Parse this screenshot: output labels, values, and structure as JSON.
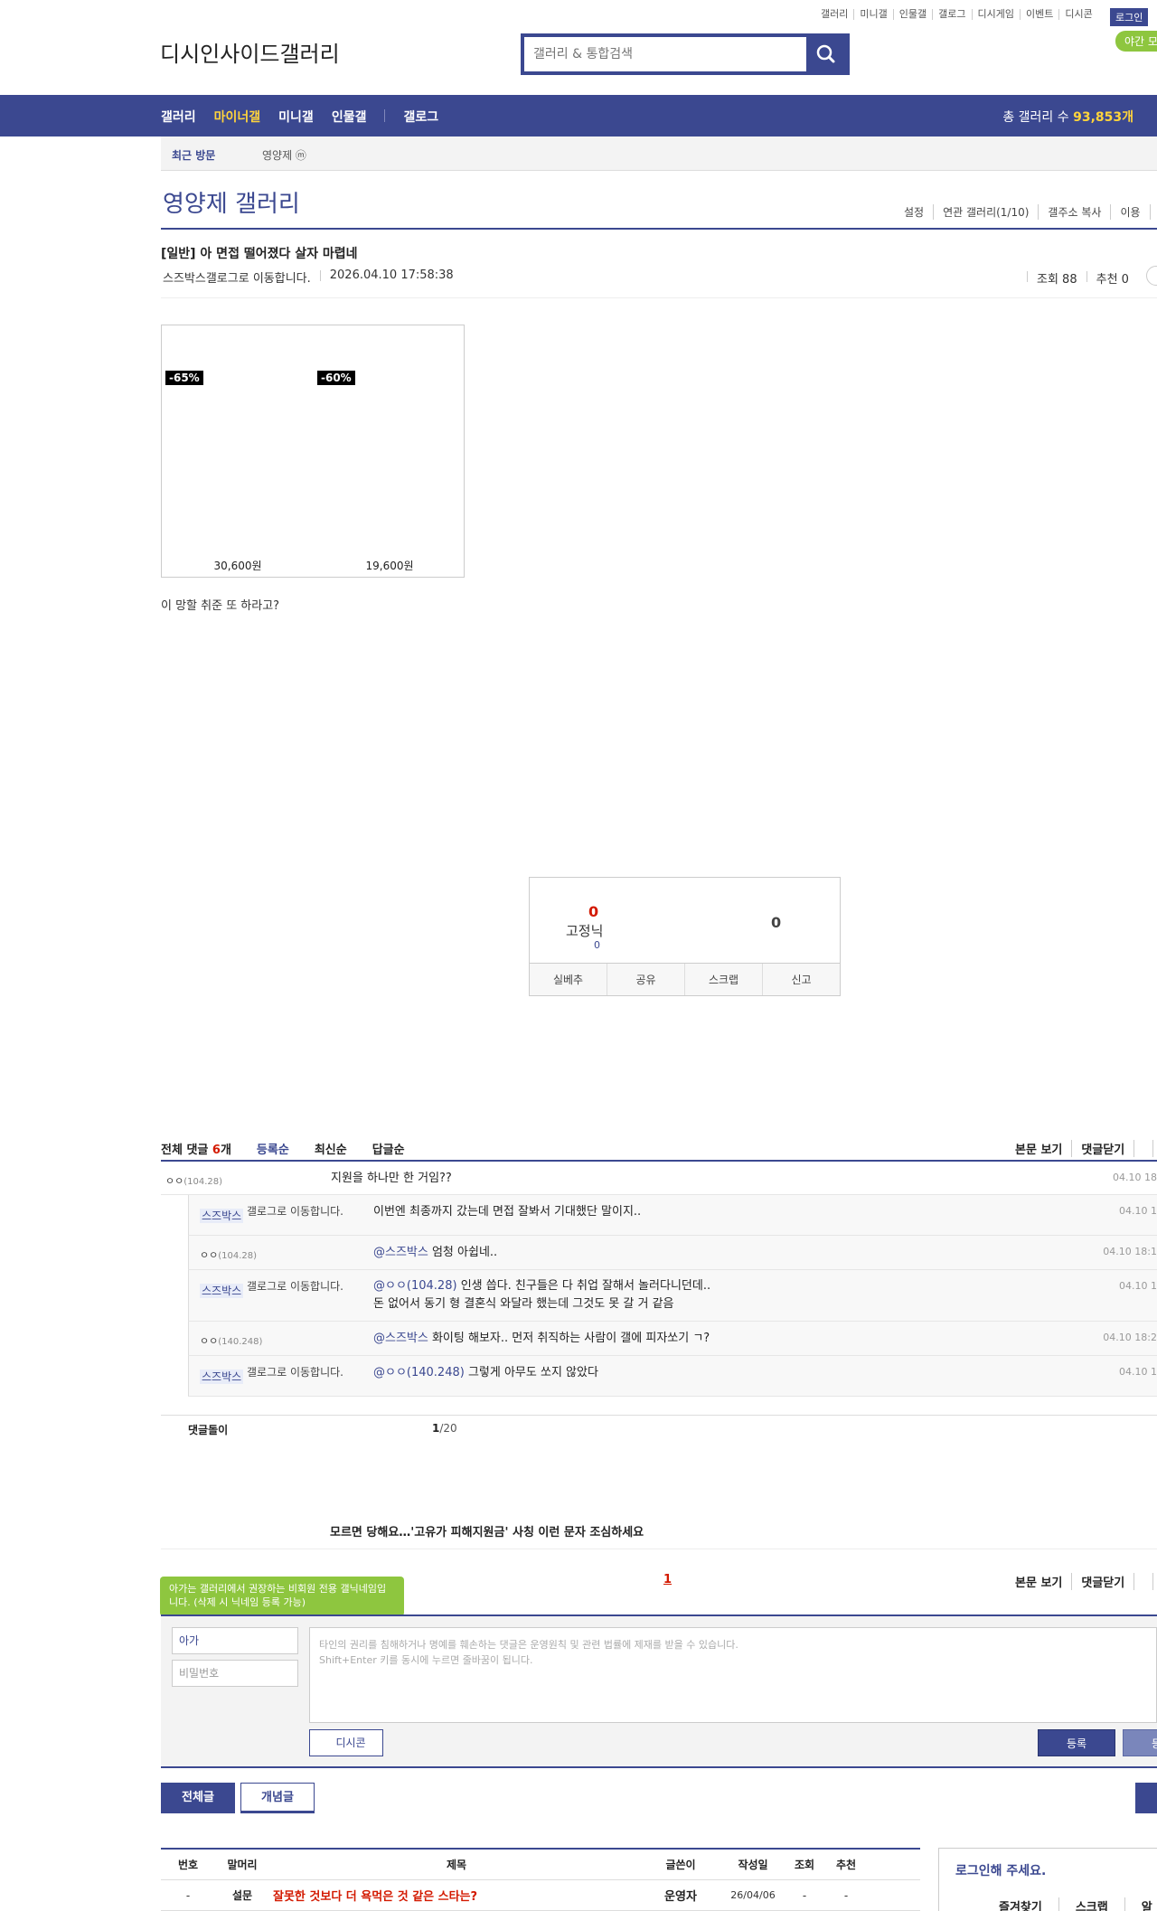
{
  "topnav": [
    "갤러리",
    "미니갤",
    "인물갤",
    "갤로그",
    "디시게임",
    "이벤트",
    "디시콘"
  ],
  "login_label": "로그인",
  "night_label": "야간 모",
  "logo_text": "디시인사이드갤러리",
  "search": {
    "placeholder": "갤러리 & 통합검색"
  },
  "gnb": {
    "items": [
      "갤러리",
      "마이너갤",
      "미니갤",
      "인물갤",
      "갤로그"
    ],
    "count_label": "총 갤러리 수 ",
    "count_value": "93,853개"
  },
  "recent_visit": {
    "label": "최근 방문",
    "item": "영양제 ⓜ"
  },
  "gallery": {
    "title": "영양제 갤러리",
    "tools": [
      "설정",
      "연관 갤러리(1/10)",
      "갤주소 복사",
      "이용"
    ]
  },
  "post": {
    "title": "[일반] 아 면접 떨어졌다 살자 마렵네",
    "writer": "스즈박스",
    "gallog_alt": "갤로그로 이동합니다.",
    "date": "2026.04.10 17:58:38",
    "views": "조회 88",
    "recommend": "추천 0",
    "body": "이 망할 취준 또 하라고?"
  },
  "products": [
    {
      "badge": "-65%",
      "price": "30,600원"
    },
    {
      "badge": "-60%",
      "price": "19,600원"
    }
  ],
  "recommend_box": {
    "up_count": "0",
    "fixed_label": "고정닉",
    "fixed_count": "0",
    "down_count": "0",
    "buttons": [
      "실베추",
      "공유",
      "스크랩",
      "신고"
    ]
  },
  "comments_header": {
    "total_label": "전체 댓글 ",
    "total_count": "6",
    "total_unit": "개",
    "sort": [
      "등록순",
      "최신순",
      "답글순"
    ],
    "right": [
      "본문 보기",
      "댓글닫기",
      ""
    ]
  },
  "comments": [
    {
      "writer": "ㅇㅇ",
      "ip": "(104.28)",
      "text": "지원을 하나만 한 거임??",
      "mention": "",
      "date": "04.10 18"
    },
    {
      "writer": "스즈박스",
      "gallog": "갤로그로 이동합니다.",
      "text": "이번엔 최종까지 갔는데 면접 잘봐서 기대했단 말이지..",
      "mention": "",
      "date": "04.10 1"
    },
    {
      "writer": "ㅇㅇ",
      "ip": "(104.28)",
      "text": " 엄청 아쉽네..",
      "mention": "@스즈박스",
      "date": "04.10 18:1"
    },
    {
      "writer": "스즈박스",
      "gallog": "갤로그로 이동합니다.",
      "text": " 인생 씁다. 친구들은 다 취업 잘해서 놀러다니던데..",
      "text2": "돈 없어서 동기 형 결혼식 와달라 했는데 그것도 못 갈 거 같음",
      "mention": "@ㅇㅇ(104.28)",
      "date": "04.10 1"
    },
    {
      "writer": "ㅇㅇ",
      "ip": "(140.248)",
      "text": " 화이팅 해보자.. 먼저 취직하는 사람이 갤에 피자쏘기 ㄱ?",
      "mention": "@스즈박스",
      "date": "04.10 18:2"
    },
    {
      "writer": "스즈박스",
      "gallog": "갤로그로 이동합니다.",
      "text": " 그렇게 아무도 쏘지 않았다",
      "mention": "@ㅇㅇ(140.248)",
      "date": "04.10 1"
    }
  ],
  "comments_footer": {
    "label": "댓글돌이",
    "page_current": "1",
    "page_total": "/20"
  },
  "news": "모르면 당해요…'고유가 피해지원금' 사칭 이런 문자 조심하세요",
  "write": {
    "tip": "아가는 갤러리에서 권장하는 비회원 전용 갤닉네임입니다. (삭제 시 닉네임 등록 가능)",
    "page": "1",
    "right": [
      "본문 보기",
      "댓글닫기",
      ""
    ],
    "name_value": "아가",
    "password_placeholder": "비밀번호",
    "textarea_placeholder": "타인의 권리를 침해하거나 명예를 훼손하는 댓글은 운영원칙 및 관련 법률에 제재를 받을 수 있습니다.\nShift+Enter 키를 동시에 누르면 줄바꿈이 됩니다.",
    "dccon_label": "디시콘",
    "submit_label": "등록",
    "submit2_label": "등록"
  },
  "list_buttons": {
    "all": "전체글",
    "concept": "개념글"
  },
  "list": {
    "headers": [
      "번호",
      "말머리",
      "제목",
      "글쓴이",
      "작성일",
      "조회",
      "추천"
    ],
    "rows": [
      {
        "num": "-",
        "head": "설문",
        "title": "잘못한 것보다 더 욕먹은 것 같은 스타는?",
        "writer": "운영자",
        "date": "26/04/06",
        "views": "-",
        "rec": "-"
      }
    ]
  },
  "login_panel": {
    "title": "로그인해 주세요.",
    "links": [
      "즐겨찾기",
      "스크랩",
      "알"
    ]
  },
  "colors": {
    "brand": "#3b4890",
    "accent": "#ffd43b",
    "alert": "#d31900",
    "green": "#8ec63f"
  }
}
